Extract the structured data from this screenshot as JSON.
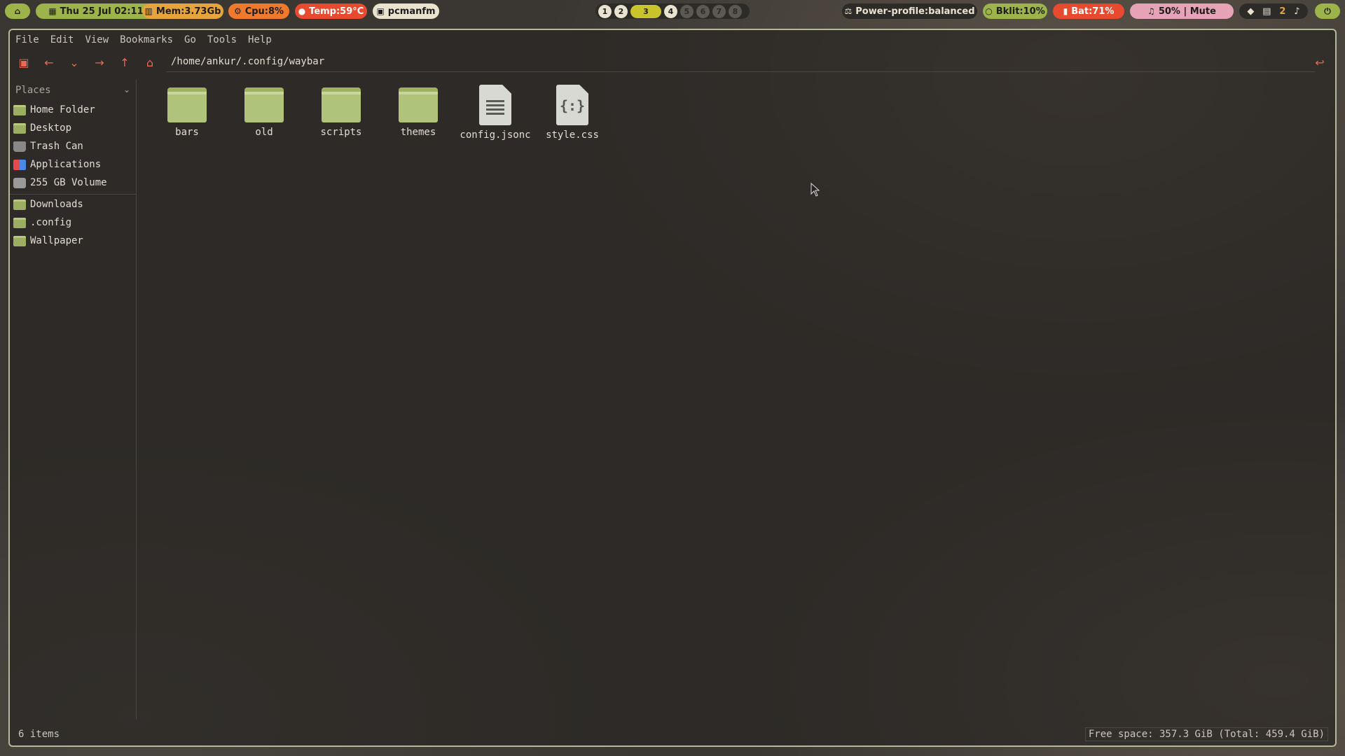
{
  "topbar": {
    "home_icon": "home-icon",
    "date": "Thu 25 Jul 02:11",
    "mem": "Mem:3.73Gb",
    "cpu": "Cpu:8%",
    "temp": "Temp:59°C",
    "active_app": "pcmanfm",
    "workspaces": [
      "1",
      "2",
      "3",
      "4",
      "5",
      "6",
      "7",
      "8"
    ],
    "active_workspace": "3",
    "power_profile": "Power-profile:balanced",
    "backlight": "Bklit:10%",
    "battery": "Bat:71%",
    "audio": "50% | Mute",
    "notifications": "2",
    "colors": {
      "green": "#9cb44a",
      "orange": "#e7a43c",
      "red": "#e84a2f",
      "dark": "#2d2b27",
      "pink": "#e6a3b8"
    }
  },
  "menubar": [
    "File",
    "Edit",
    "View",
    "Bookmarks",
    "Go",
    "Tools",
    "Help"
  ],
  "toolbar": {
    "path": "/home/ankur/.config/waybar"
  },
  "sidebar": {
    "header": "Places",
    "places": [
      {
        "label": "Home Folder",
        "icon": "home-folder-icon"
      },
      {
        "label": "Desktop",
        "icon": "desktop-folder-icon"
      },
      {
        "label": "Trash Can",
        "icon": "trash-icon"
      },
      {
        "label": "Applications",
        "icon": "applications-icon"
      },
      {
        "label": "255 GB Volume",
        "icon": "drive-icon"
      }
    ],
    "bookmarks": [
      {
        "label": "Downloads",
        "icon": "downloads-folder-icon"
      },
      {
        "label": ".config",
        "icon": "folder-icon"
      },
      {
        "label": "Wallpaper",
        "icon": "folder-icon"
      }
    ]
  },
  "files": [
    {
      "name": "bars",
      "type": "folder"
    },
    {
      "name": "old",
      "type": "folder"
    },
    {
      "name": "scripts",
      "type": "folder"
    },
    {
      "name": "themes",
      "type": "folder"
    },
    {
      "name": "config.jsonc",
      "type": "text"
    },
    {
      "name": "style.css",
      "type": "css"
    }
  ],
  "status": {
    "items": "6 items",
    "free_space": "Free space: 357.3 GiB (Total: 459.4 GiB)"
  }
}
